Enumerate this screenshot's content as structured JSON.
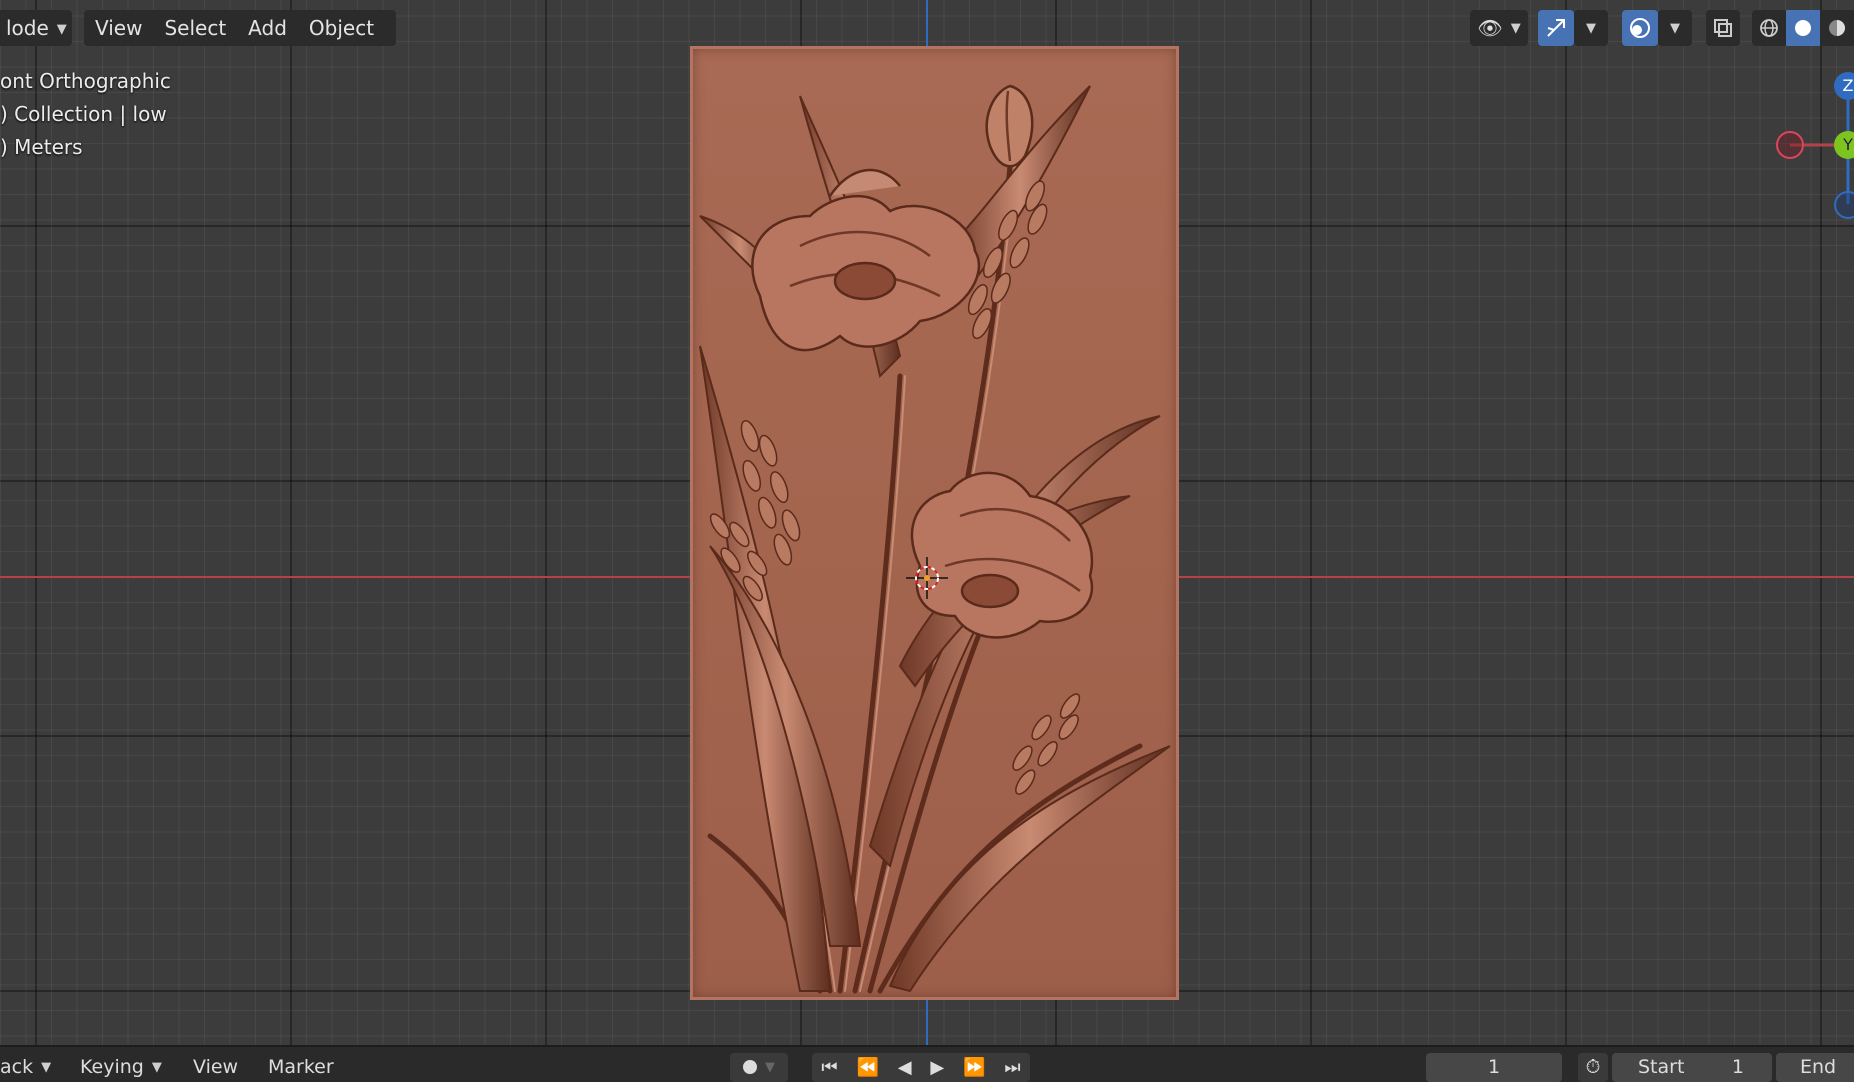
{
  "header": {
    "mode_label": "lode",
    "menus": [
      "View",
      "Select",
      "Add",
      "Object"
    ]
  },
  "overlay": {
    "view_name": "ont Orthographic",
    "collection": ") Collection | low",
    "units": ") Meters"
  },
  "gizmo": {
    "z_label": "Z",
    "y_label": "Y"
  },
  "timeline": {
    "playback_label": "ack",
    "keying_label": "Keying",
    "view_label": "View",
    "marker_label": "Marker",
    "current_frame": "1",
    "start_label": "Start",
    "start_value": "1",
    "end_label": "End"
  },
  "colors": {
    "axis_x": "#b3424a",
    "axis_z": "#2f6bc0",
    "panel": "#a4654f",
    "active_button": "#4772b3"
  },
  "icons": [
    "visibility-icon",
    "gizmo-toggle-icon",
    "overlay-icon",
    "xray-icon",
    "wireframe-shading-icon",
    "solid-shading-icon",
    "material-shading-icon",
    "3d-cursor-icon"
  ]
}
